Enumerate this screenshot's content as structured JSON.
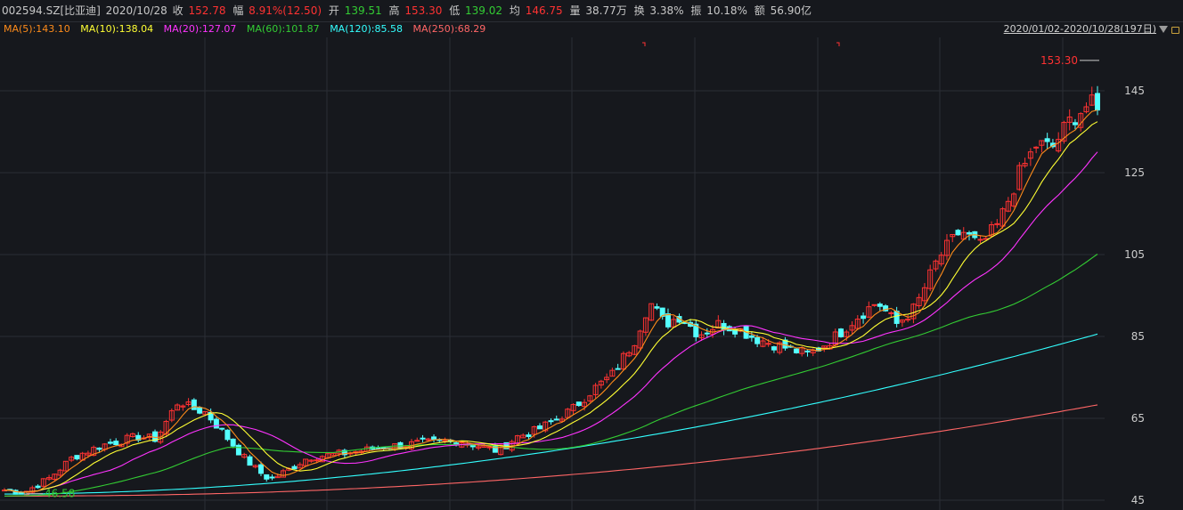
{
  "header": {
    "code": "002594.SZ[比亚迪]",
    "date": "2020/10/28",
    "close_label": "收",
    "close": "152.78",
    "change_label": "幅",
    "change": "8.91%(12.50)",
    "open_label": "开",
    "open": "139.51",
    "high_label": "高",
    "high": "153.30",
    "low_label": "低",
    "low": "139.02",
    "avg_label": "均",
    "avg": "146.75",
    "volume_label": "量",
    "volume": "38.77万",
    "turnover_label": "换",
    "turnover": "3.38%",
    "amplitude_label": "振",
    "amplitude": "10.18%",
    "amount_label": "额",
    "amount": "56.90亿"
  },
  "ma_bar": {
    "items": [
      {
        "label": "MA(5):143.10",
        "color": "#ff8c1a"
      },
      {
        "label": "MA(10):138.04",
        "color": "#ffff33"
      },
      {
        "label": "MA(20):127.07",
        "color": "#ff33ff"
      },
      {
        "label": "MA(60):101.87",
        "color": "#33cc33"
      },
      {
        "label": "MA(120):85.58",
        "color": "#33ffff"
      },
      {
        "label": "MA(250):68.29",
        "color": "#ff6666"
      }
    ],
    "range": "2020/01/02-2020/10/28(197日)"
  },
  "colors": {
    "up": "#ff3232",
    "down": "#54ffff",
    "grid": "#2b2e35",
    "axis_text": "#cccccc",
    "high_marker": "#ff3232",
    "low_marker": "#33cc33"
  },
  "chart_data": {
    "type": "candlestick",
    "y_ticks": [
      "145",
      "125",
      "105",
      "85",
      "65",
      "45"
    ],
    "ylim": [
      45,
      155
    ],
    "max_label": "153.30",
    "min_label": "46.58",
    "candles": 197,
    "ma_final": {
      "MA5": 143.1,
      "MA10": 138.04,
      "MA20": 127.07,
      "MA60": 101.87,
      "MA120": 85.58,
      "MA250": 68.29
    },
    "keypoints": [
      [
        0,
        47.5
      ],
      [
        5,
        46.8
      ],
      [
        12,
        50.5
      ],
      [
        18,
        55.5
      ],
      [
        26,
        58.5
      ],
      [
        35,
        60.5
      ],
      [
        40,
        60
      ],
      [
        46,
        69.5
      ],
      [
        49,
        67.5
      ],
      [
        53,
        66.5
      ],
      [
        58,
        61
      ],
      [
        63,
        55.5
      ],
      [
        67,
        52
      ],
      [
        70,
        50
      ],
      [
        75,
        52.5
      ],
      [
        80,
        55.5
      ],
      [
        90,
        56.5
      ],
      [
        100,
        58
      ],
      [
        110,
        59
      ],
      [
        120,
        59.5
      ],
      [
        130,
        57
      ],
      [
        135,
        60.5
      ],
      [
        140,
        62
      ],
      [
        145,
        64.5
      ],
      [
        150,
        67.5
      ],
      [
        155,
        72
      ],
      [
        160,
        75.5
      ],
      [
        166,
        84
      ],
      [
        170,
        93.5
      ],
      [
        174,
        88
      ],
      [
        178,
        90
      ],
      [
        183,
        85.5
      ],
      [
        188,
        88
      ],
      [
        193,
        87
      ],
      [
        198,
        84.5
      ],
      [
        205,
        82.5
      ],
      [
        212,
        80.5
      ],
      [
        219,
        85
      ],
      [
        225,
        90
      ],
      [
        230,
        93.5
      ],
      [
        235,
        88
      ],
      [
        240,
        92
      ],
      [
        246,
        104
      ],
      [
        252,
        111
      ],
      [
        257,
        107
      ],
      [
        262,
        112.5
      ],
      [
        267,
        124
      ],
      [
        272,
        132
      ],
      [
        276,
        131
      ],
      [
        281,
        138
      ],
      [
        286,
        142
      ],
      [
        288,
        140.3
      ]
    ]
  }
}
